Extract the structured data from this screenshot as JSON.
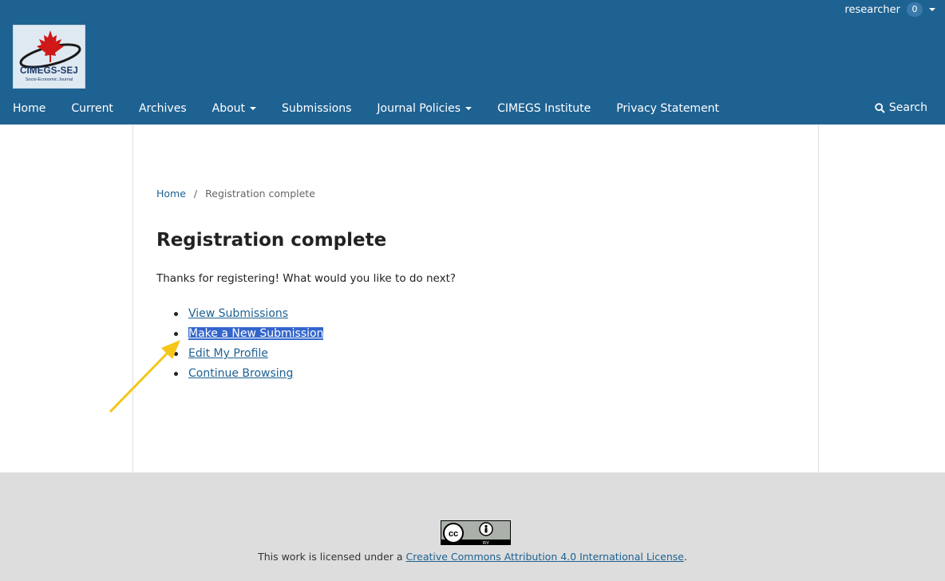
{
  "header": {
    "user": {
      "name": "researcher",
      "notification_count": "0"
    },
    "logo": {
      "title": "CIMEGS-SEJ",
      "subtitle": "Socio-Economic Journal"
    },
    "nav": [
      {
        "label": "Home"
      },
      {
        "label": "Current"
      },
      {
        "label": "Archives"
      },
      {
        "label": "About"
      },
      {
        "label": "Submissions"
      },
      {
        "label": "Journal Policies"
      },
      {
        "label": "CIMEGS Institute"
      },
      {
        "label": "Privacy Statement"
      }
    ],
    "search_label": "Search"
  },
  "main": {
    "breadcrumb": {
      "home": "Home",
      "separator": "/",
      "current": "Registration complete"
    },
    "title": "Registration complete",
    "intro": "Thanks for registering! What would you like to do next?",
    "links": [
      {
        "label": "View Submissions"
      },
      {
        "label": "Make a New Submission"
      },
      {
        "label": "Edit My Profile"
      },
      {
        "label": "Continue Browsing"
      }
    ]
  },
  "footer": {
    "license_prefix": "This work is licensed under a ",
    "license_link": "Creative Commons Attribution 4.0 International License",
    "license_suffix": ".",
    "cc_badge_text": "BY"
  },
  "colors": {
    "header_bg": "#1e6292",
    "link": "#1e6292",
    "selection": "#3366cc",
    "arrow": "#f5c518",
    "footer_bg": "#dddddd"
  },
  "icons": {
    "search": "search-icon",
    "dropdown": "caret-down-icon",
    "arrow": "annotation-arrow-icon"
  }
}
